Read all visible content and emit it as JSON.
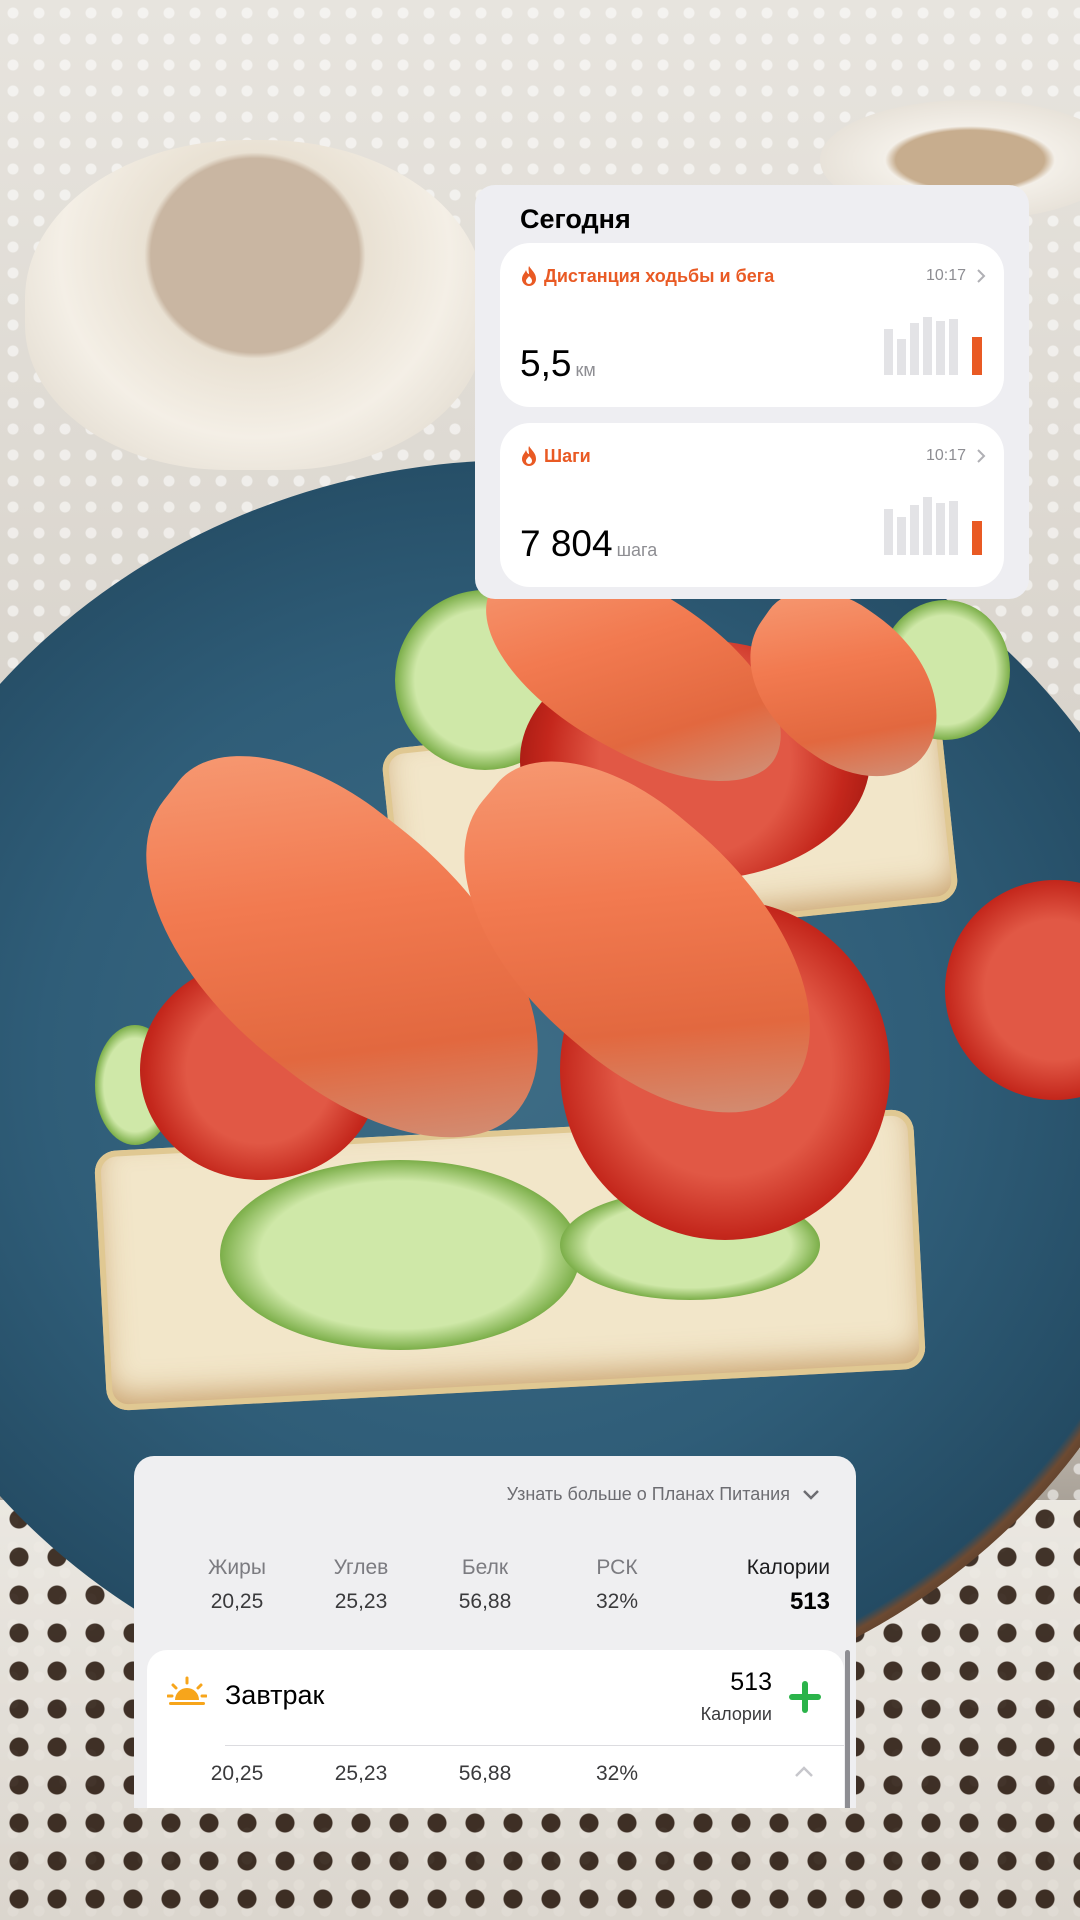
{
  "today": {
    "title": "Сегодня",
    "metrics": [
      {
        "label": "Дистанция ходьбы и бега",
        "time": "10:17",
        "value": "5,5",
        "unit": "км"
      },
      {
        "label": "Шаги",
        "time": "10:17",
        "value": "7 804",
        "unit": "шага"
      }
    ]
  },
  "nutrition": {
    "learn_more": "Узнать больше о Планах Питания",
    "headers": {
      "fat": "Жиры",
      "carbs": "Углев",
      "protein": "Белк",
      "rsk": "РСК",
      "calories": "Калории"
    },
    "totals": {
      "fat": "20,25",
      "carbs": "25,23",
      "protein": "56,88",
      "rsk": "32%",
      "calories": "513"
    },
    "meal": {
      "name": "Завтрак",
      "calories": "513",
      "calories_label": "Калории",
      "fat": "20,25",
      "carbs": "25,23",
      "protein": "56,88",
      "rsk": "32%"
    }
  },
  "colors": {
    "accent_orange": "#e95a24",
    "plus_green": "#2bb34a",
    "sun_yellow": "#f7a51b"
  }
}
